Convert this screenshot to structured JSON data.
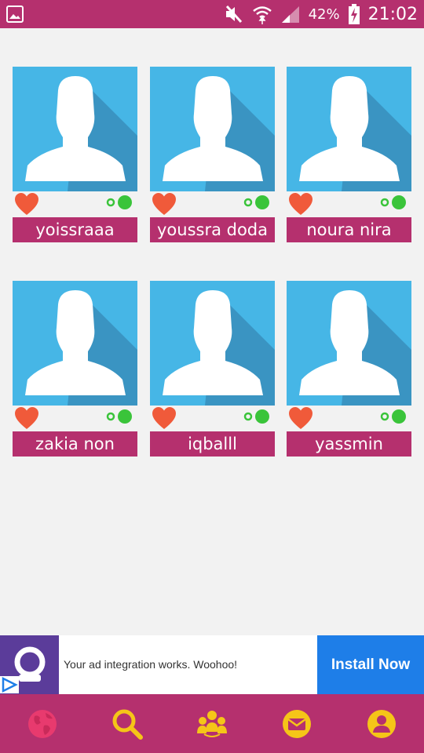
{
  "status_bar": {
    "battery_percent": "42%",
    "time": "21:02",
    "icons": [
      "gallery-icon",
      "mute-icon",
      "wifi-icon",
      "signal-icon",
      "battery-charging-icon"
    ]
  },
  "profiles": [
    {
      "name": "yoissraaa",
      "online": true
    },
    {
      "name": "youssra doda",
      "online": true
    },
    {
      "name": "noura nira",
      "online": true
    },
    {
      "name": "zakia non",
      "online": true
    },
    {
      "name": "iqballl",
      "online": true
    },
    {
      "name": "yassmin",
      "online": true
    }
  ],
  "ad": {
    "text": "Your ad integration works. Woohoo!",
    "install_label": "Install Now"
  },
  "bottom_nav": {
    "items": [
      "globe-icon",
      "search-icon",
      "people-icon",
      "mail-icon",
      "profile-icon"
    ],
    "active": "globe-icon"
  },
  "colors": {
    "brand": "#b5306e",
    "avatar_bg": "#46b6e6",
    "heart": "#f05a3a",
    "online": "#3ac43a",
    "nav_icon": "#f5c518",
    "ad_button": "#1e7ee8"
  }
}
